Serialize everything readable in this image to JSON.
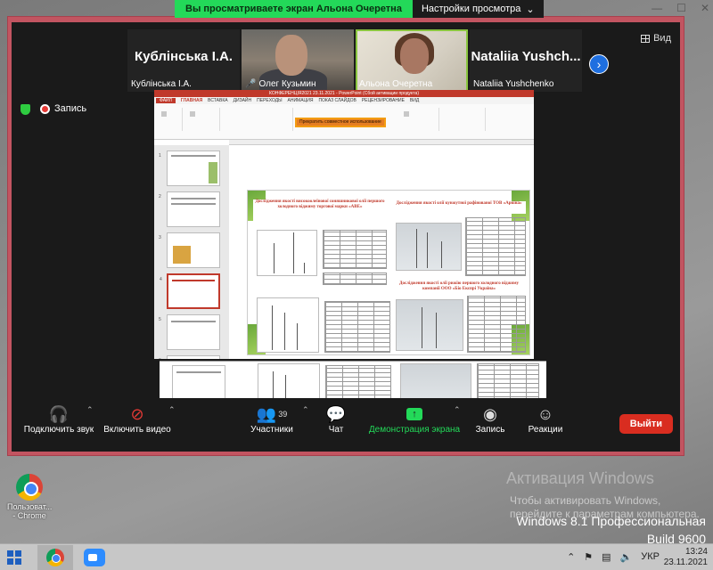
{
  "share_bar": {
    "status": "Вы просматриваете экран Альона Очеретна",
    "options": "Настройки просмотра"
  },
  "window": {
    "minimize": "—",
    "maximize": "☐",
    "close": "✕"
  },
  "participants_strip": {
    "tiles": [
      {
        "big_name": "Кублінська І.А.",
        "label": "Кублінська І.А.",
        "muted": false,
        "camera": false
      },
      {
        "big_name": "",
        "label": "Олег Кузьмин",
        "muted": true,
        "camera": true
      },
      {
        "big_name": "",
        "label": "Альона Очеретна",
        "muted": false,
        "camera": true,
        "speaking": true
      },
      {
        "big_name": "Nataliia  Yushch...",
        "label": "Nataliia Yushchenko",
        "muted": false,
        "camera": false
      }
    ],
    "view_label": "Вид"
  },
  "recording": {
    "label": "Запись"
  },
  "shared_screen": {
    "title_bar": "КОНФЕРЕНЦІЯ2021 23.11.2021 - PowerPoint (Сбой активации продукта)",
    "tabs": [
      "ФАЙЛ",
      "ГЛАВНАЯ",
      "ВСТАВКА",
      "ДИЗАЙН",
      "ПЕРЕХОДЫ",
      "АНИМАЦИЯ",
      "ПОКАЗ СЛАЙДОВ",
      "РЕЦЕНЗИРОВАНИЕ",
      "ВИД"
    ],
    "stop_share": "Прекратить совместное использование",
    "slide_left_title": "Дослідження якості високоолеїнової соняшникової олії першого холодного віджиму торгової марки «АВЕ»",
    "slide_right_title": "Дослідження якості олії кунжутної рафінованої ТОВ «Арвіна»",
    "slide_right_title2": "Дослідження якості олії рижію першого холодного віджиму компанії ООО «Біо Експрі Україна»"
  },
  "toolbar": {
    "audio": "Подключить звук",
    "video": "Включить видео",
    "participants": "Участники",
    "participants_count": "39",
    "chat": "Чат",
    "share": "Демонстрация экрана",
    "record": "Запись",
    "reactions": "Реакции",
    "leave": "Выйти"
  },
  "desktop": {
    "icon_label": "Пользоват... - Chrome",
    "watermark_title": "Активация Windows",
    "watermark_line1": "Чтобы активировать Windows,",
    "watermark_line2": "перейдите к параметрам компьютера.",
    "os_name": "Windows 8.1 Профессиональная",
    "build": "Build 9600"
  },
  "taskbar": {
    "lang": "УКР",
    "time": "13:24",
    "date": "23.11.2021"
  },
  "colors": {
    "zoom_border": "#c25561",
    "share_green": "#23d959",
    "leave_red": "#d92d20",
    "ppt_accent": "#c0392b"
  }
}
